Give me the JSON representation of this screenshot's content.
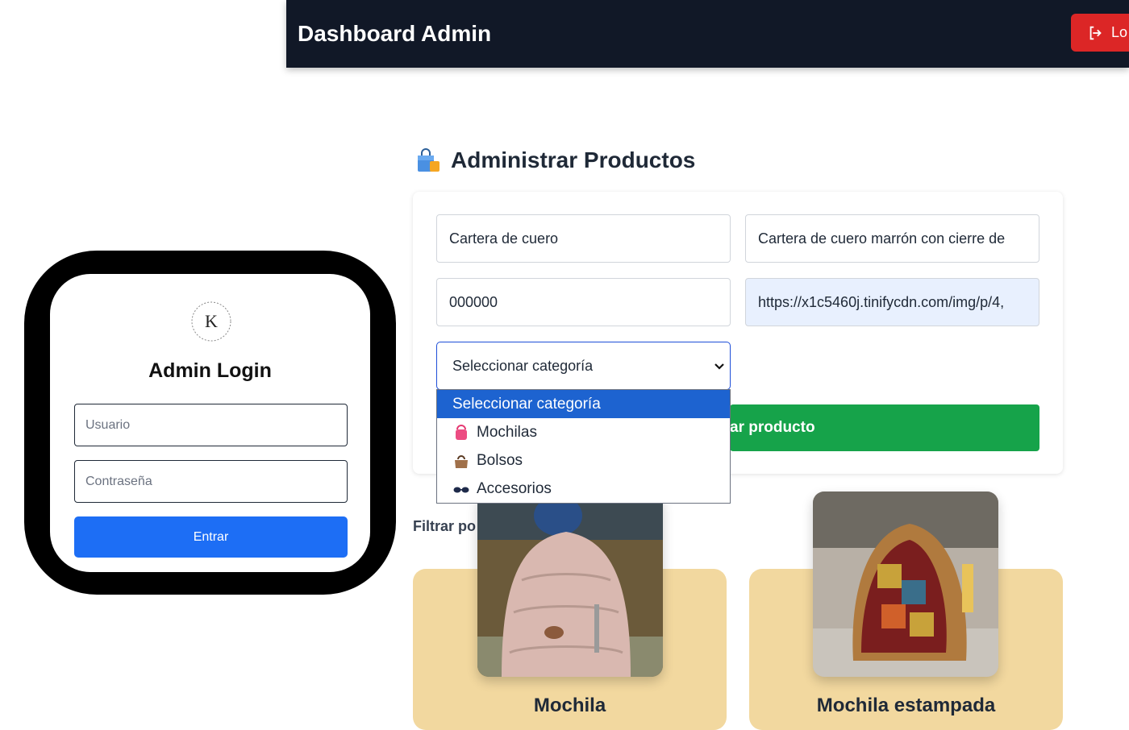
{
  "header": {
    "title": "Dashboard Admin",
    "logout_label": "Lo"
  },
  "section": {
    "title": "Administrar Productos",
    "icon": "shopping-bag-icon"
  },
  "form": {
    "name_value": "Cartera de cuero",
    "description_value": "Cartera de cuero marrón con cierre de",
    "price_value": "000000",
    "image_url_value": "https://x1c5460j.tinifycdn.com/img/p/4,",
    "category_selected": "Seleccionar categoría",
    "submit_label": "ar producto"
  },
  "dropdown": {
    "options": [
      {
        "label": "Seleccionar categoría",
        "icon": ""
      },
      {
        "label": "Mochilas",
        "icon": "pink-backpack-icon"
      },
      {
        "label": "Bolsos",
        "icon": "brown-handbag-icon"
      },
      {
        "label": "Accesorios",
        "icon": "sunglasses-icon"
      }
    ]
  },
  "filter": {
    "label": "Filtrar po"
  },
  "products": [
    {
      "name": "Mochila"
    },
    {
      "name": "Mochila estampada"
    }
  ],
  "login": {
    "logo_letter": "K",
    "title": "Admin Login",
    "username_placeholder": "Usuario",
    "password_placeholder": "Contraseña",
    "submit_label": "Entrar"
  },
  "colors": {
    "nav_bg": "#111827",
    "logout_red": "#dc2626",
    "green_button": "#16a34a",
    "card_bg": "#f2d89f",
    "login_button": "#1d6ef5",
    "dropdown_highlight": "#1d63d0"
  }
}
